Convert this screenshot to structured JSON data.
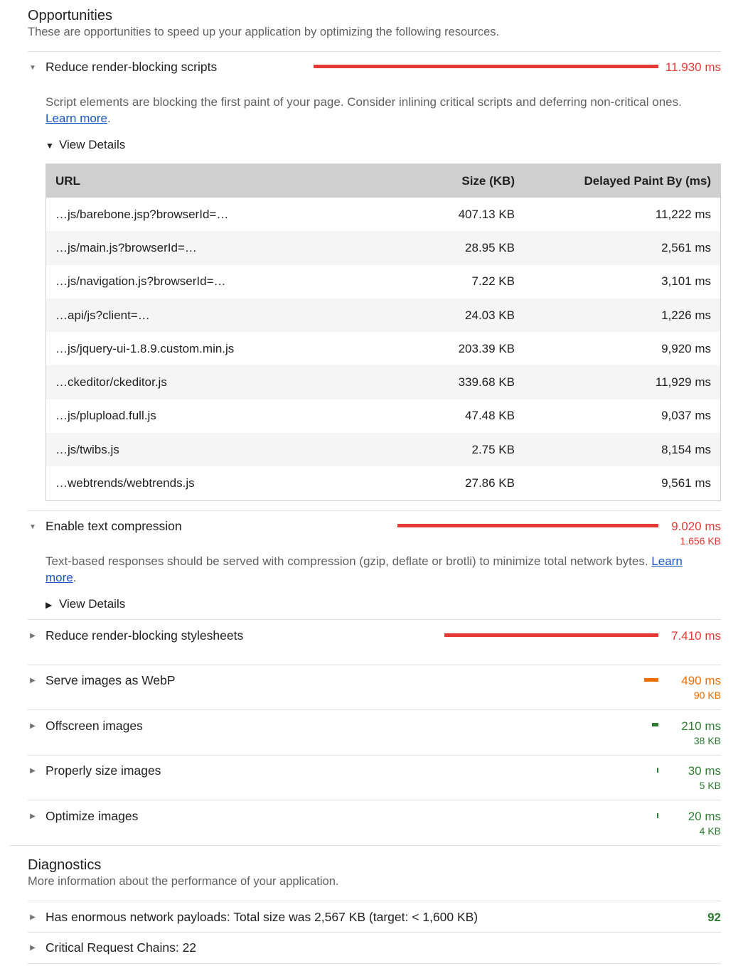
{
  "opportunities": {
    "title": "Opportunities",
    "description": "These are opportunities to speed up your application by optimizing the following resources.",
    "items": [
      {
        "title": "Reduce render-blocking scripts",
        "value": "11.930 ms",
        "bar_fraction": 1.0,
        "color": "#e53935",
        "description": "Script elements are blocking the first paint of your page. Consider inlining critical scripts and deferring non-critical ones.",
        "learn_more": "Learn more",
        "view_details": "View Details",
        "table": {
          "headers": [
            "URL",
            "Size (KB)",
            "Delayed Paint By (ms)"
          ],
          "rows": [
            [
              "…js/barebone.jsp?browserId=…",
              "407.13 KB",
              "11,222 ms"
            ],
            [
              "…js/main.js?browserId=…",
              "28.95 KB",
              "2,561 ms"
            ],
            [
              "…js/navigation.js?browserId=…",
              "7.22 KB",
              "3,101 ms"
            ],
            [
              "…api/js?client=…",
              "24.03 KB",
              "1,226 ms"
            ],
            [
              "…js/jquery-ui-1.8.9.custom.min.js",
              "203.39 KB",
              "9,920 ms"
            ],
            [
              "…ckeditor/ckeditor.js",
              "339.68 KB",
              "11,929 ms"
            ],
            [
              "…js/plupload.full.js",
              "47.48 KB",
              "9,037 ms"
            ],
            [
              "…js/twibs.js",
              "2.75 KB",
              "8,154 ms"
            ],
            [
              "…webtrends/webtrends.js",
              "27.86 KB",
              "9,561 ms"
            ]
          ]
        }
      },
      {
        "title": "Enable text compression",
        "value": "9.020 ms",
        "sub": "1.656 KB",
        "bar_fraction": 0.756,
        "color": "#e53935",
        "description": "Text-based responses should be served with compression (gzip, deflate or brotli) to minimize total network bytes.",
        "learn_more_1": "Learn",
        "learn_more_2": "more",
        "view_details": "View Details"
      },
      {
        "title": "Reduce render-blocking stylesheets",
        "value": "7.410 ms",
        "bar_fraction": 0.621,
        "color": "#e53935"
      },
      {
        "title": "Serve images as WebP",
        "value": "490 ms",
        "sub": "90 KB",
        "bar_fraction": 0.041,
        "color": "#ef6c00"
      },
      {
        "title": "Offscreen images",
        "value": "210 ms",
        "sub": "38 KB",
        "bar_fraction": 0.018,
        "color": "#2e7d32"
      },
      {
        "title": "Properly size images",
        "value": "30 ms",
        "sub": "5 KB",
        "bar_fraction": 0.003,
        "color": "#2e7d32"
      },
      {
        "title": "Optimize images",
        "value": "20 ms",
        "sub": "4 KB",
        "bar_fraction": 0.002,
        "color": "#2e7d32"
      }
    ]
  },
  "diagnostics": {
    "title": "Diagnostics",
    "description": "More information about the performance of your application.",
    "items": [
      {
        "title": "Has enormous network payloads: Total size was 2,567 KB (target: < 1,600 KB)",
        "score": "92"
      },
      {
        "title": "Critical Request Chains: 22"
      }
    ]
  }
}
